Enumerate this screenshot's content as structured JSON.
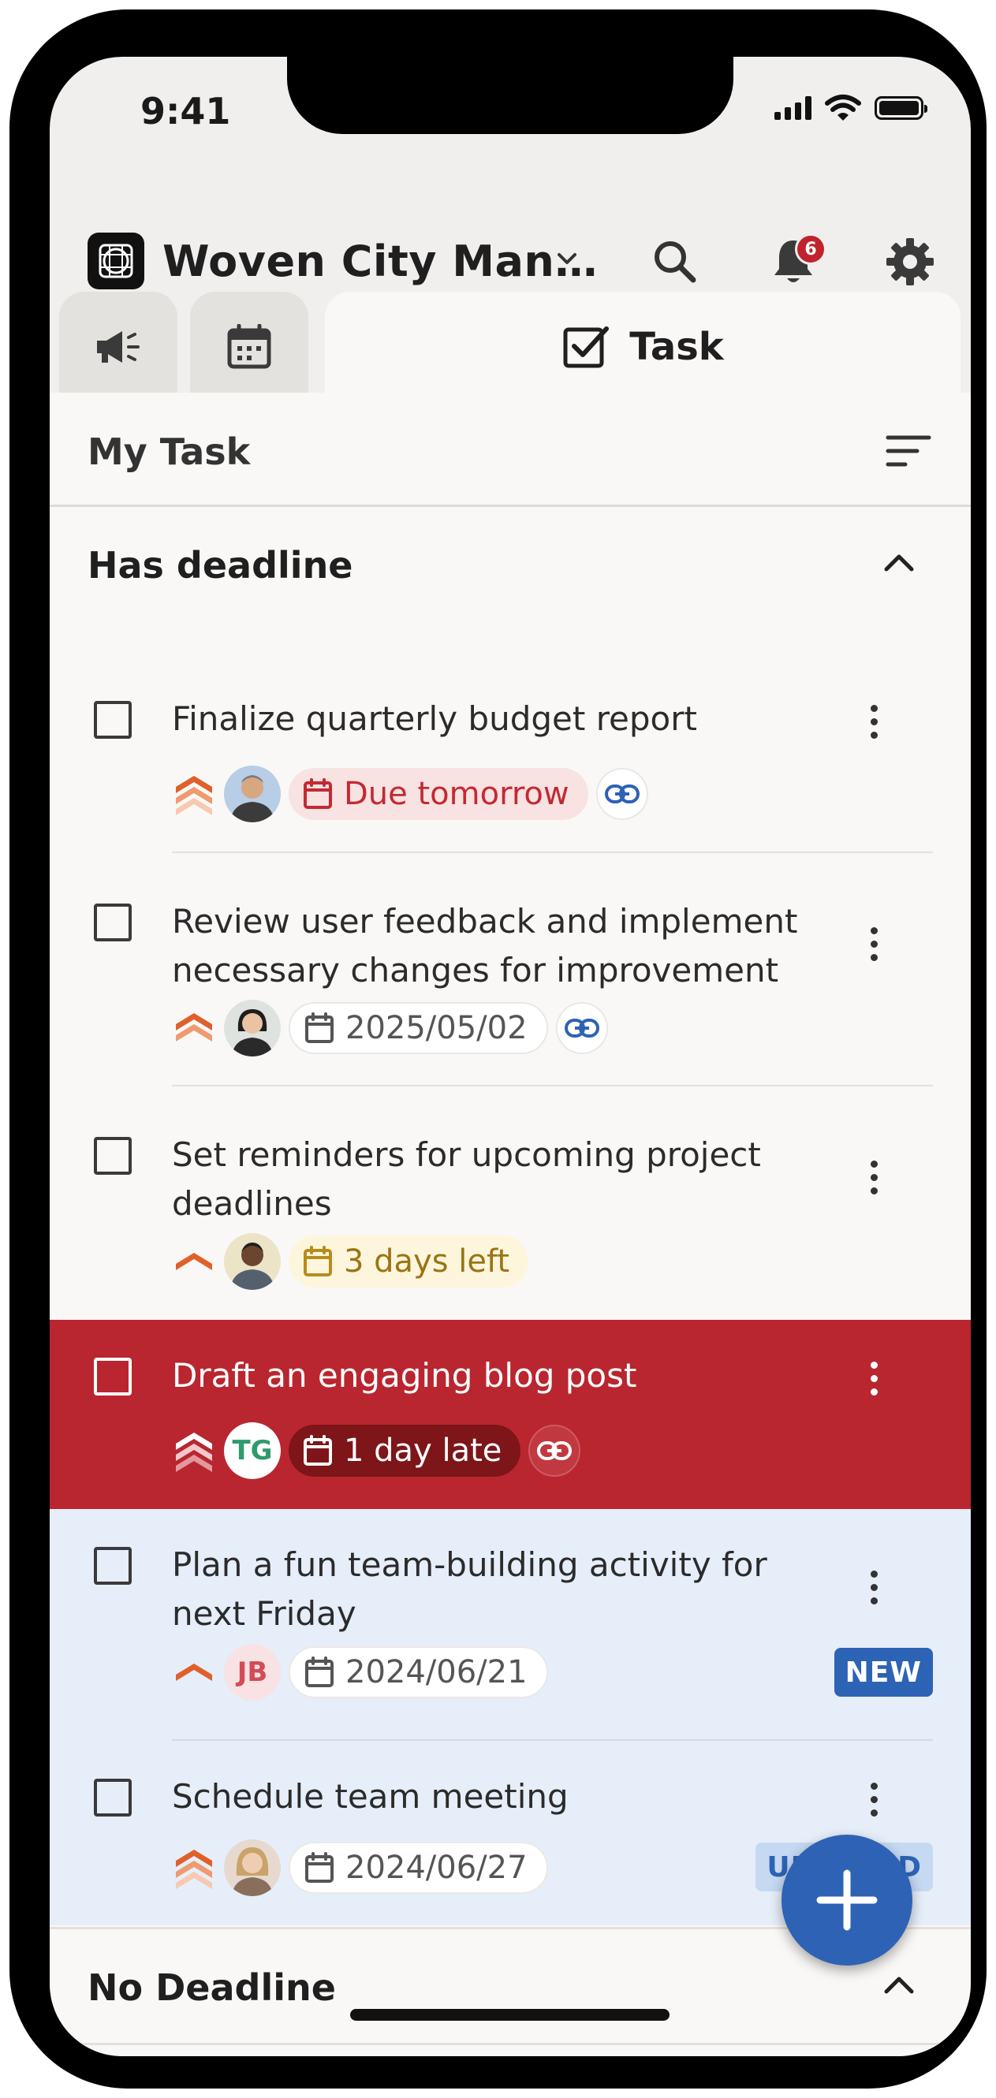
{
  "status_bar": {
    "time": "9:41"
  },
  "header": {
    "app_title": "Woven City Man…",
    "notification_count": "6"
  },
  "tabs": [
    {
      "name": "announcements",
      "icon": "megaphone-icon"
    },
    {
      "name": "calendar",
      "icon": "calendar-icon"
    },
    {
      "name": "task",
      "icon": "checkbox-icon",
      "label": "Task"
    }
  ],
  "my_task": {
    "title": "My Task"
  },
  "sections": {
    "has_deadline": "Has deadline",
    "no_deadline": "No Deadline"
  },
  "tasks": [
    {
      "title": "Finalize quarterly budget report",
      "priority": "highest",
      "assignee": "photo",
      "due": "Due tomorrow",
      "due_style": "red",
      "has_link": true
    },
    {
      "title": "Review user feedback and implement necessary changes for improvement",
      "priority": "high",
      "assignee": "photo",
      "due": "2025/05/02",
      "due_style": "gray",
      "has_link": true
    },
    {
      "title": "Set reminders for upcoming project deadlines",
      "priority": "medium",
      "assignee": "photo",
      "due": "3 days left",
      "due_style": "yellow",
      "has_link": false
    },
    {
      "title": "Draft an engaging blog post",
      "priority": "highest",
      "assignee": "TG",
      "due": "1 day late",
      "due_style": "overdue",
      "has_link": true
    },
    {
      "title": "Plan a fun team-building activity for next Friday",
      "priority": "medium",
      "assignee": "JB",
      "due": "2024/06/21",
      "due_style": "gray",
      "has_link": false,
      "tag": "NEW"
    },
    {
      "title": "Schedule team meeting",
      "priority": "highest",
      "assignee": "photo",
      "due": "2024/06/27",
      "due_style": "gray",
      "has_link": false,
      "tag": "UPDATED"
    }
  ],
  "colors": {
    "accent": "#2e62b4",
    "overdue_row": "#b9262f",
    "highlight_row": "#e6eef9",
    "due_red": "#c22a33",
    "priority_orange": "#e0602a"
  }
}
